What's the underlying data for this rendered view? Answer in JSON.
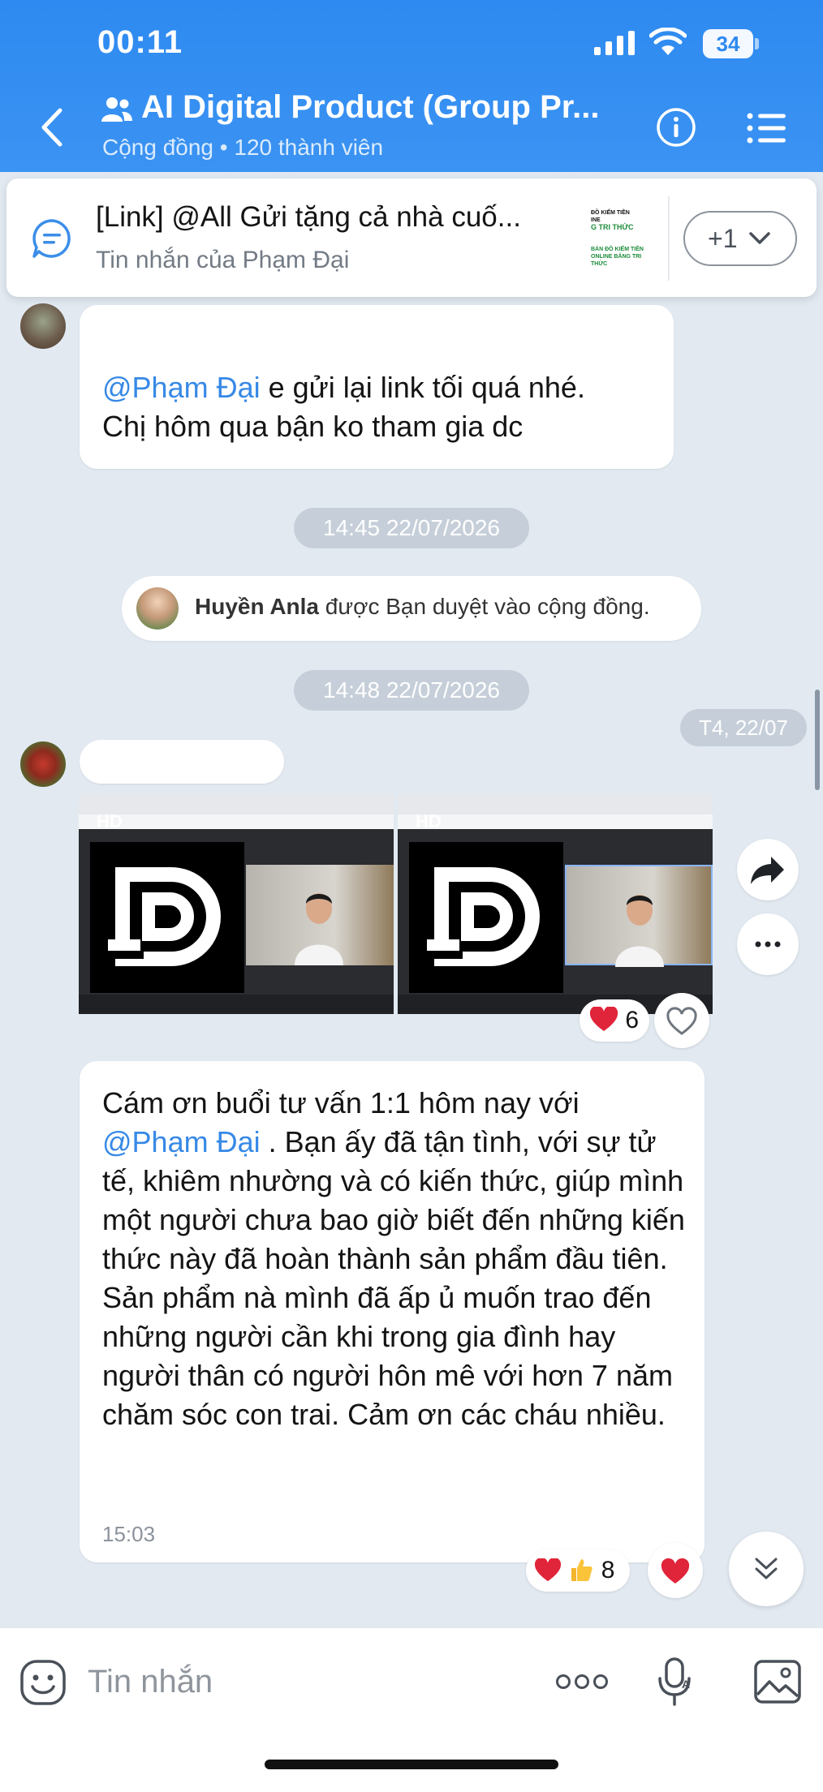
{
  "status_bar": {
    "time": "00:11",
    "battery": "34"
  },
  "header": {
    "title": "AI Digital Product (Group Pr...",
    "subtitle": "Cộng đồng • 120 thành viên",
    "icons": [
      "back-icon",
      "group-icon",
      "info-icon",
      "menu-icon"
    ]
  },
  "pinned": {
    "title": "[Link] @All Gửi tặng cả nhà cuố...",
    "subtitle": "Tin nhắn của Phạm Đại",
    "thumb_lines": [
      "ĐỒ KIẾM TIỀN",
      "INE",
      "G TRI THỨC",
      "BẢN ĐỒ KIẾM TIỀN",
      "ONLINE BẰNG TRI THỨC"
    ],
    "more_label": "+1"
  },
  "messages": {
    "m1": {
      "mention": "@Phạm Đại",
      "line1_rest": " e gửi lại link tối quá nhé.",
      "line2": "Chị hôm qua bận ko tham gia dc"
    },
    "time1": "14:45 22/07/2026",
    "notice": {
      "name": "Huyền Anla",
      "rest": " được Bạn duyệt vào cộng đồng."
    },
    "time2": "14:48 22/07/2026",
    "date_label": "T4, 22/07",
    "video": {
      "badge1": "HD",
      "badge2": "HD",
      "reaction_count": "6"
    },
    "m3": {
      "line1": "Cám ơn buổi tư vấn 1:1 hôm nay với",
      "mention": "@Phạm Đại",
      "rest": " . Bạn ấy đã tận tình, với sự tử tế, khiêm nhường và có kiến thức, giúp mình một người chưa bao giờ biết đến những kiến thức này đã hoàn thành sản phẩm đầu tiên. Sản phẩm nà mình đã ấp ủ muốn trao đến những người cần khi trong gia đình hay người thân có người hôn mê với hơn 7 năm chăm sóc con trai. Cảm ơn các cháu nhiều.",
      "time": "15:03",
      "reaction_count": "8"
    }
  },
  "input": {
    "placeholder": "Tin nhắn"
  },
  "colors": {
    "header": "#2e8af0",
    "mention": "#3789e6",
    "background": "#e2e9f1",
    "heart": "#e0243a"
  }
}
